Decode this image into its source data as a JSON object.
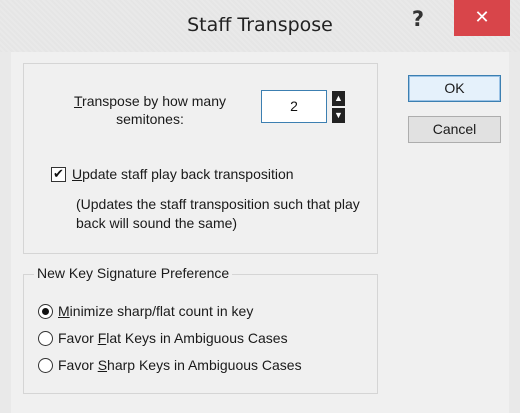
{
  "window": {
    "title": "Staff Transpose",
    "help": "?",
    "close": "✕"
  },
  "transpose": {
    "label_underline": "T",
    "label_rest": "ranspose by how many semitones:",
    "semitones_value": "2",
    "spinner_up": "▲",
    "spinner_down": "▼"
  },
  "update_playback": {
    "checked": true,
    "check_glyph": "✔",
    "label_underline": "U",
    "label_rest": "pdate staff play back transposition",
    "note": "(Updates the staff transposition such that play back will sound the same)"
  },
  "key_signature": {
    "group_label": "New Key Signature Preference",
    "options": [
      {
        "pre": "",
        "underline": "M",
        "post": "inimize sharp/flat count in key",
        "selected": true
      },
      {
        "pre": "Favor ",
        "underline": "F",
        "post": "lat Keys in Ambiguous Cases",
        "selected": false
      },
      {
        "pre": "Favor ",
        "underline": "S",
        "post": "harp Keys in Ambiguous Cases",
        "selected": false
      }
    ]
  },
  "buttons": {
    "ok": "OK",
    "cancel": "Cancel"
  }
}
